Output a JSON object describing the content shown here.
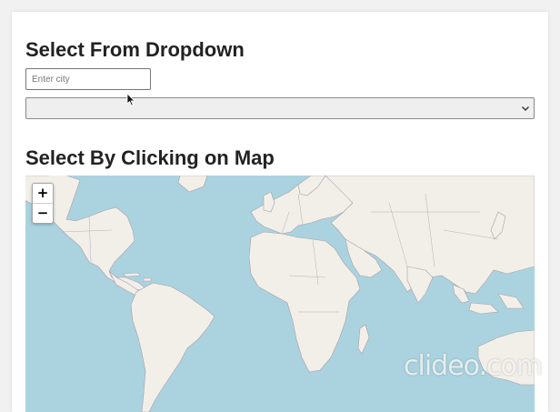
{
  "dropdown_section": {
    "heading": "Select From Dropdown",
    "city_input": {
      "placeholder": "Enter city",
      "value": ""
    },
    "city_select": {
      "selected": ""
    }
  },
  "map_section": {
    "heading": "Select By Clicking on Map",
    "zoom_in_label": "+",
    "zoom_out_label": "−"
  },
  "watermark": "clideo.com",
  "colors": {
    "ocean": "#aad3df",
    "land": "#f2efe9",
    "border": "#a79fa9",
    "heading": "#222222"
  }
}
